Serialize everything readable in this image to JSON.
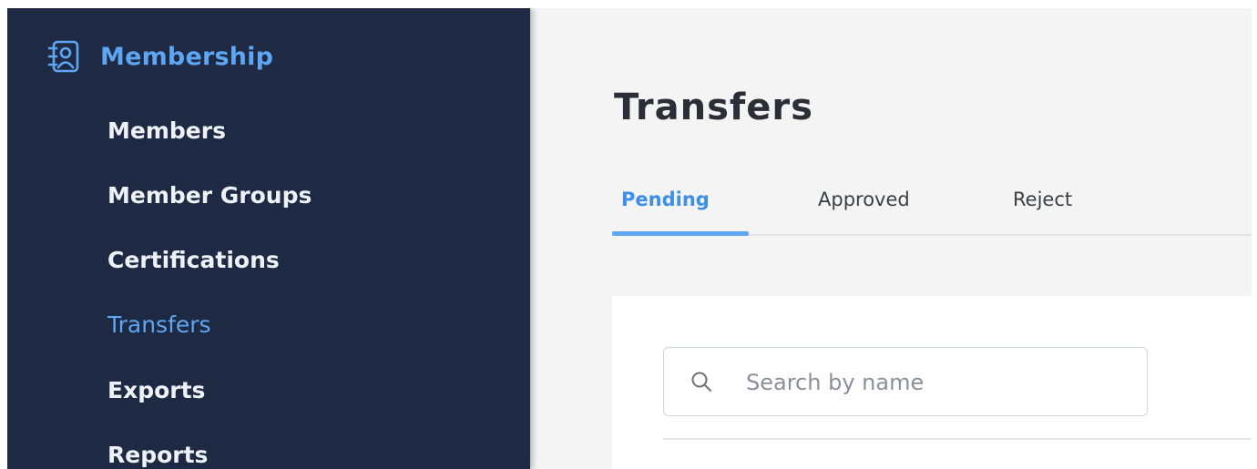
{
  "sidebar": {
    "section": {
      "title": "Membership",
      "icon": "contact-book-icon"
    },
    "items": [
      {
        "label": "Members",
        "active": false
      },
      {
        "label": "Member Groups",
        "active": false
      },
      {
        "label": "Certifications",
        "active": false
      },
      {
        "label": "Transfers",
        "active": true
      },
      {
        "label": "Exports",
        "active": false
      },
      {
        "label": "Reports",
        "active": false
      }
    ]
  },
  "main": {
    "title": "Transfers",
    "tabs": [
      {
        "label": "Pending",
        "active": true
      },
      {
        "label": "Approved",
        "active": false
      },
      {
        "label": "Reject",
        "active": false
      }
    ],
    "search": {
      "placeholder": "Search by name",
      "value": "",
      "icon": "search-icon"
    }
  },
  "colors": {
    "sidebar_bg": "#1e2a44",
    "accent": "#5ea6f3",
    "main_bg": "#f4f4f4"
  }
}
